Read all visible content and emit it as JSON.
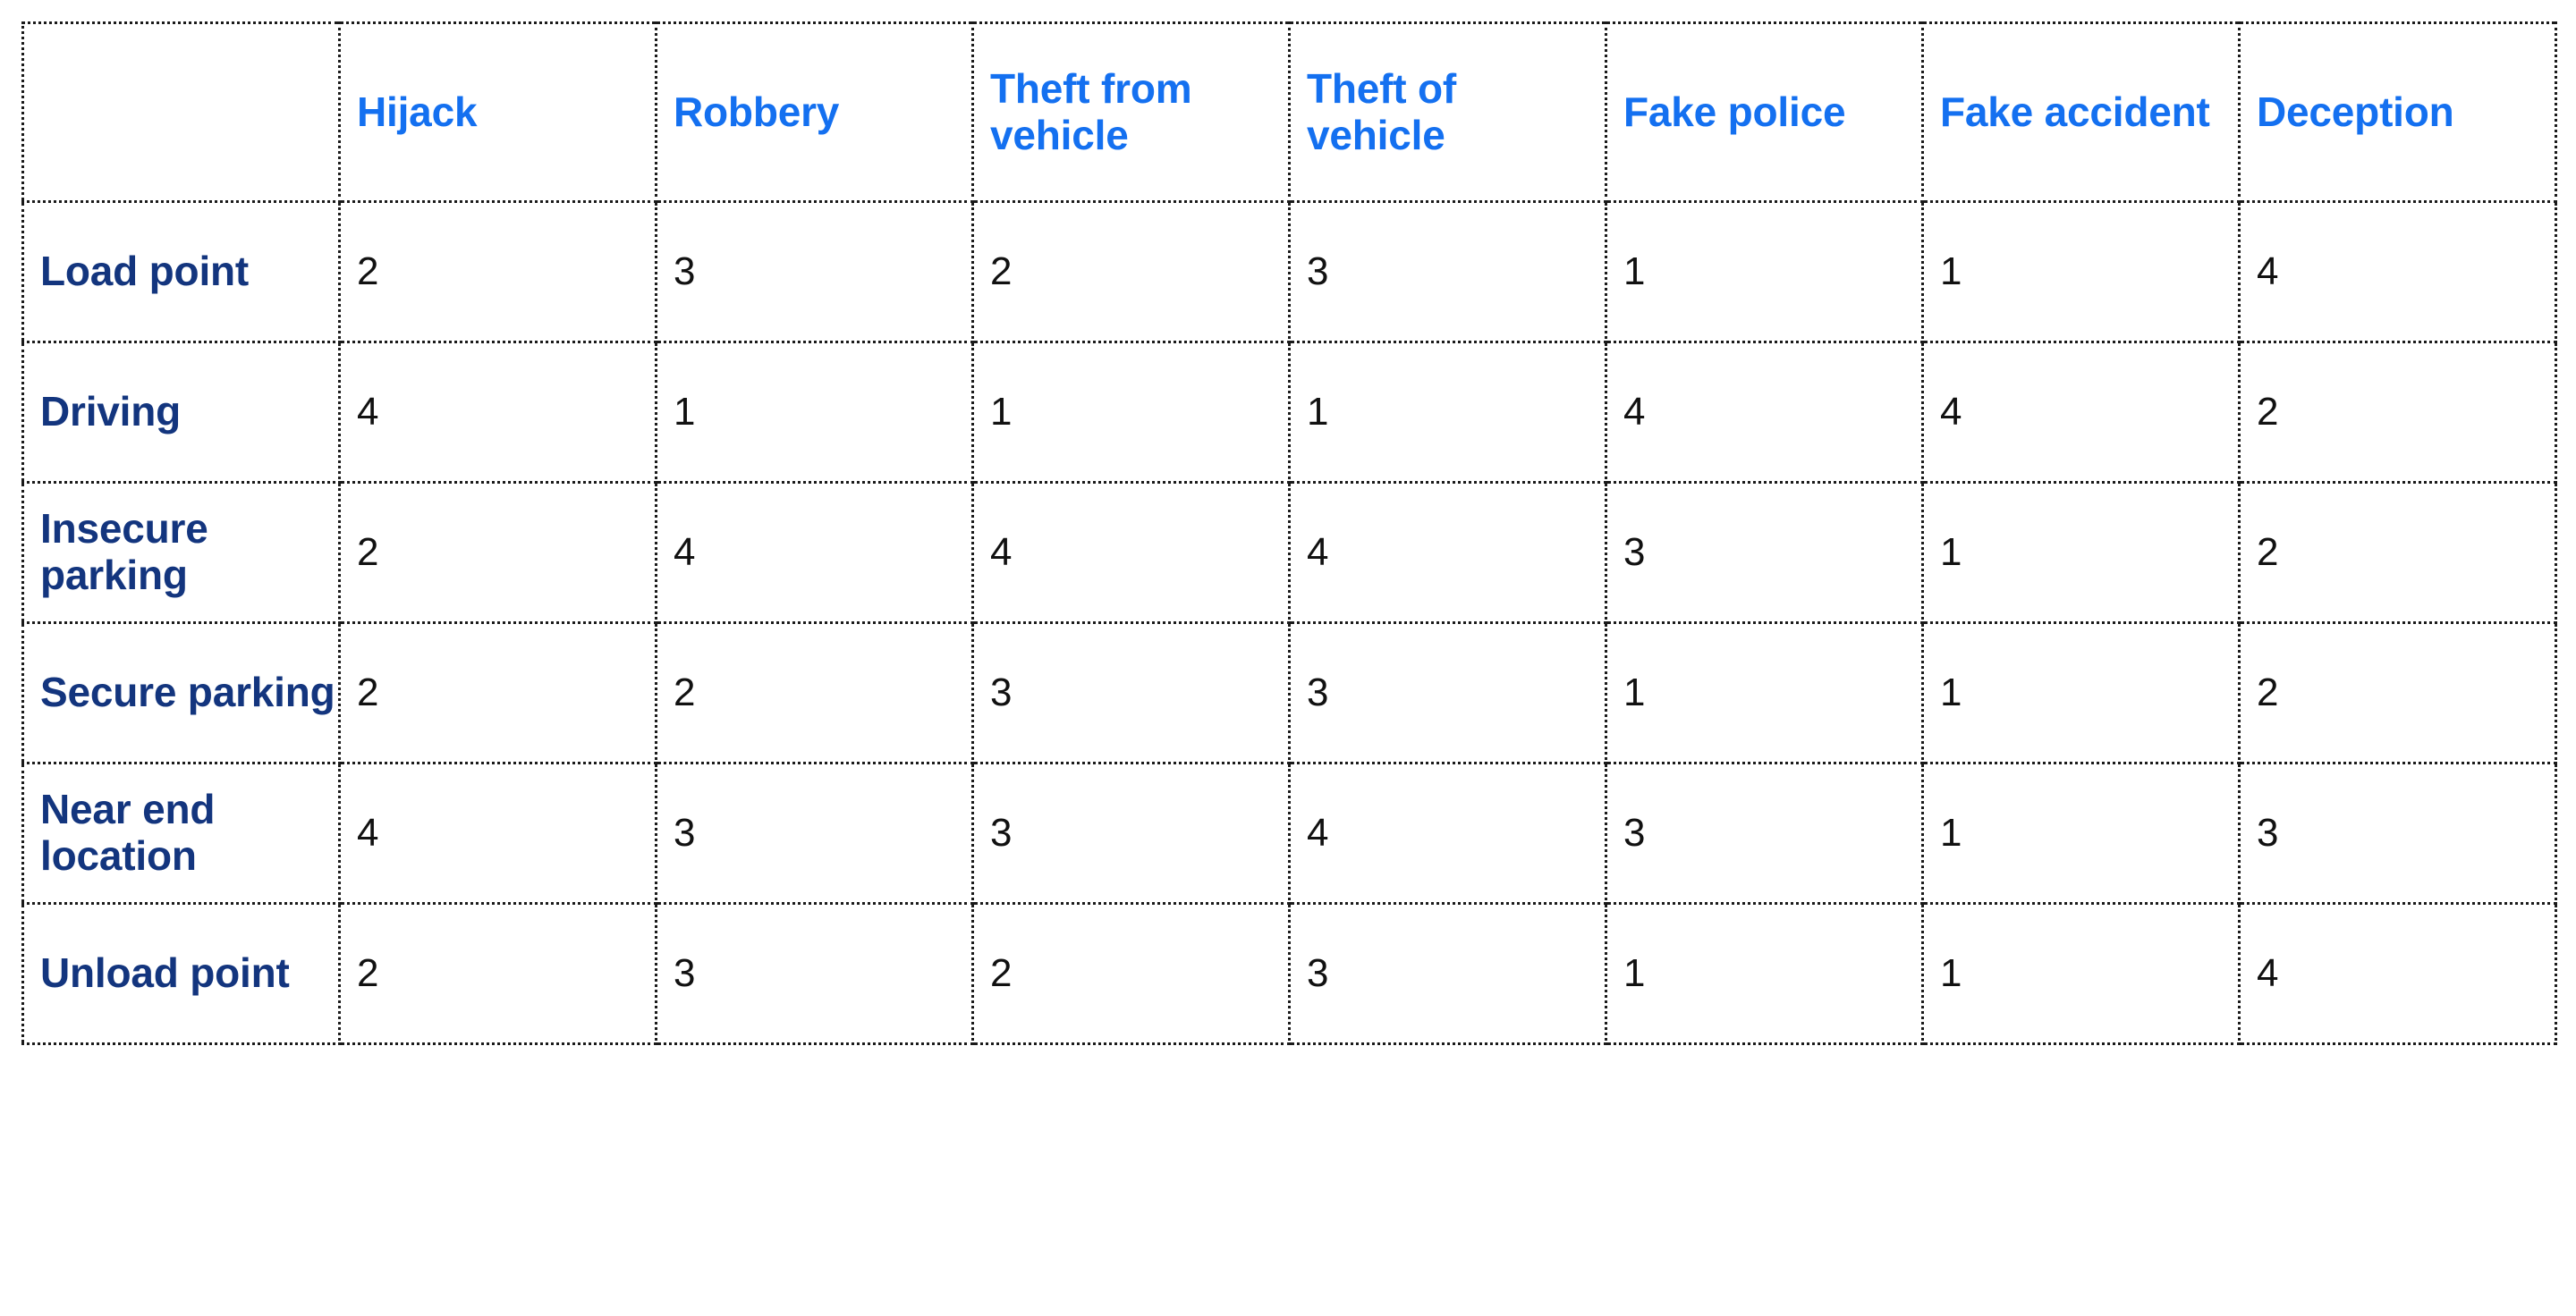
{
  "table": {
    "corner_label": "",
    "column_headers": [
      "Hijack",
      "Robbery",
      "Theft from vehicle",
      "Theft of vehicle",
      "Fake police",
      "Fake accident",
      "Deception"
    ],
    "row_headers": [
      "Load point",
      "Driving",
      "Insecure parking",
      "Secure parking",
      "Near end location",
      "Unload point"
    ],
    "rows": [
      {
        "label": "Load point",
        "values": [
          "2",
          "3",
          "2",
          "3",
          "1",
          "1",
          "4"
        ]
      },
      {
        "label": "Driving",
        "values": [
          "4",
          "1",
          "1",
          "1",
          "4",
          "4",
          "2"
        ]
      },
      {
        "label": "Insecure parking",
        "values": [
          "2",
          "4",
          "4",
          "4",
          "3",
          "1",
          "2"
        ]
      },
      {
        "label": "Secure parking",
        "values": [
          "2",
          "2",
          "3",
          "3",
          "1",
          "1",
          "2"
        ]
      },
      {
        "label": "Near end location",
        "values": [
          "4",
          "3",
          "3",
          "4",
          "3",
          "1",
          "3"
        ]
      },
      {
        "label": "Unload point",
        "values": [
          "2",
          "3",
          "2",
          "3",
          "1",
          "1",
          "4"
        ]
      }
    ]
  },
  "chart_data": {
    "type": "table",
    "title": "",
    "categories": [
      "Hijack",
      "Robbery",
      "Theft from vehicle",
      "Theft of vehicle",
      "Fake police",
      "Fake accident",
      "Deception"
    ],
    "row_categories": [
      "Load point",
      "Driving",
      "Insecure parking",
      "Secure parking",
      "Near end location",
      "Unload point"
    ],
    "series": [
      {
        "name": "Load point",
        "values": [
          2,
          3,
          2,
          3,
          1,
          1,
          4
        ]
      },
      {
        "name": "Driving",
        "values": [
          4,
          1,
          1,
          1,
          4,
          4,
          2
        ]
      },
      {
        "name": "Insecure parking",
        "values": [
          2,
          4,
          4,
          4,
          3,
          1,
          2
        ]
      },
      {
        "name": "Secure parking",
        "values": [
          2,
          2,
          3,
          3,
          1,
          1,
          2
        ]
      },
      {
        "name": "Near end location",
        "values": [
          4,
          3,
          3,
          4,
          3,
          1,
          3
        ]
      },
      {
        "name": "Unload point",
        "values": [
          2,
          3,
          2,
          3,
          1,
          1,
          4
        ]
      }
    ],
    "value_range": [
      1,
      4
    ],
    "xlabel": "",
    "ylabel": "",
    "grid": true,
    "legend": "none"
  },
  "colors": {
    "column_header_text": "#1470f0",
    "row_header_text": "#13357e",
    "cell_text": "#111111",
    "border": "#1a1a1a",
    "background": "#ffffff"
  }
}
